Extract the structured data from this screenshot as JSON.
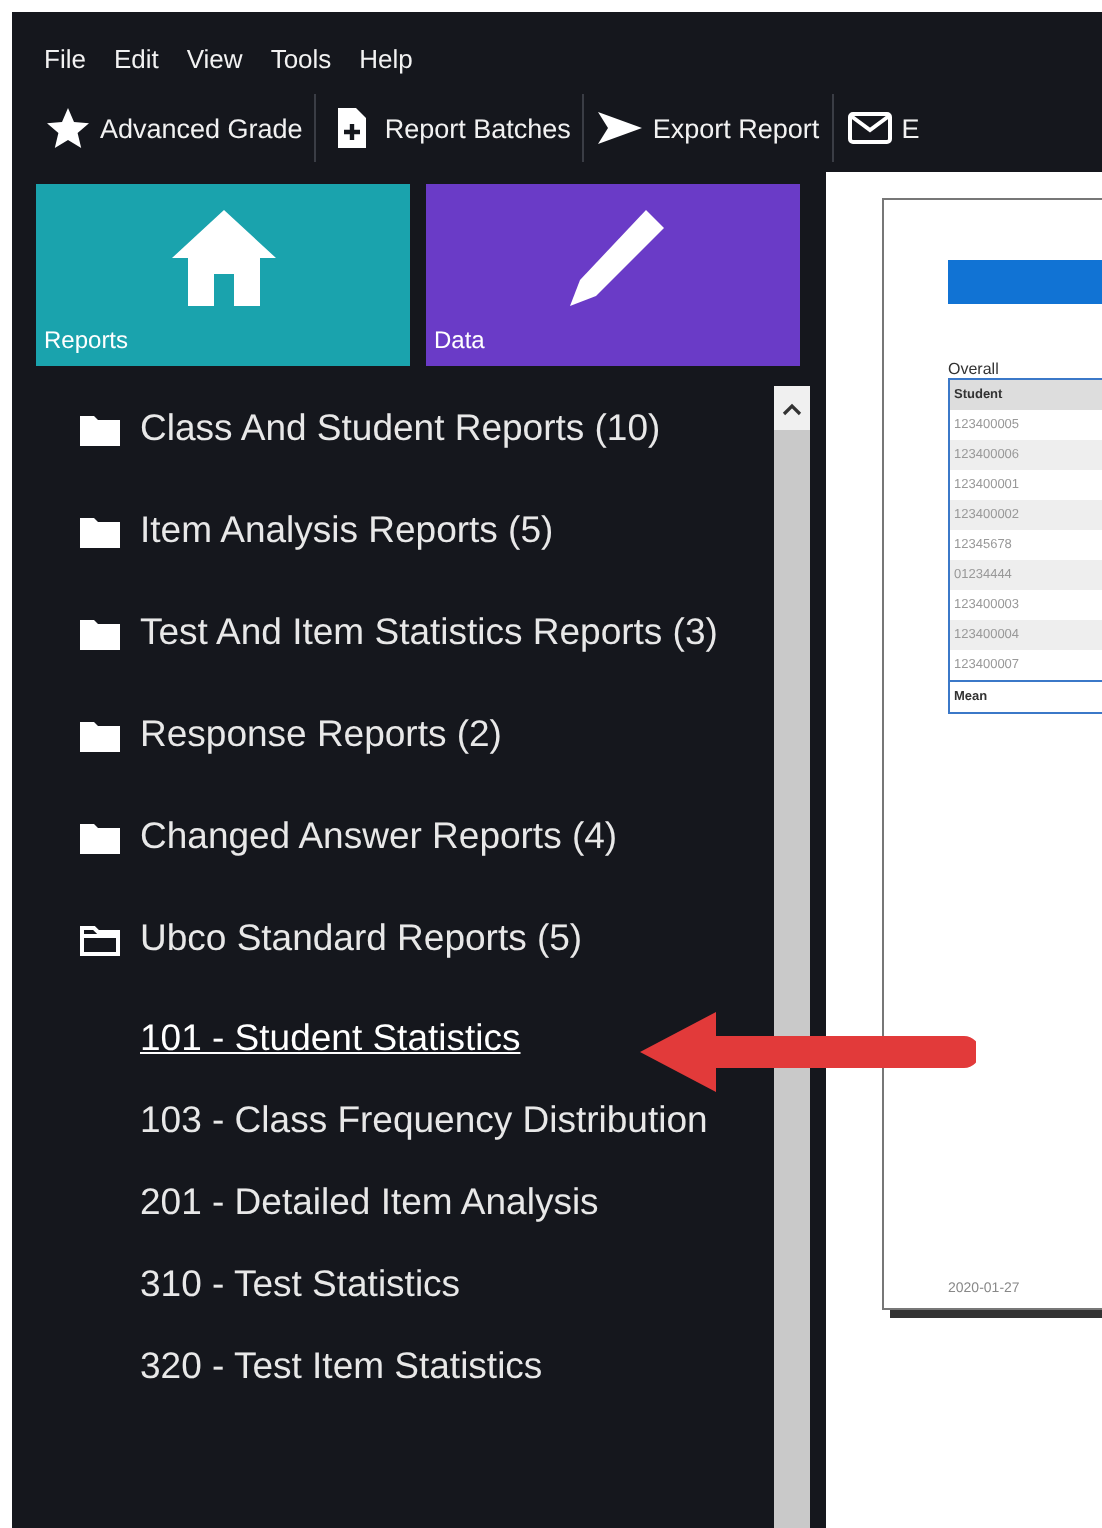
{
  "menu": [
    {
      "label": "File"
    },
    {
      "label": "Edit"
    },
    {
      "label": "View"
    },
    {
      "label": "Tools"
    },
    {
      "label": "Help"
    }
  ],
  "toolbar": [
    {
      "label": "Advanced Grade"
    },
    {
      "label": "Report Batches"
    },
    {
      "label": "Export Report"
    },
    {
      "label": "E"
    }
  ],
  "tiles": [
    {
      "label": "Reports",
      "color": "#1aa3ad"
    },
    {
      "label": "Data",
      "color": "#6a3bc7"
    }
  ],
  "tree": [
    {
      "label": "Class And Student Reports (10)",
      "expanded": false
    },
    {
      "label": "Item Analysis Reports (5)",
      "expanded": false
    },
    {
      "label": "Test And Item Statistics Reports (3)",
      "expanded": false
    },
    {
      "label": "Response Reports (2)",
      "expanded": false
    },
    {
      "label": "Changed Answer Reports (4)",
      "expanded": false
    },
    {
      "label": "Ubco Standard Reports (5)",
      "expanded": true,
      "children": [
        {
          "label": "101 - Student Statistics",
          "selected": true
        },
        {
          "label": "103 - Class Frequency Distribution",
          "selected": false
        },
        {
          "label": "201 - Detailed Item Analysis",
          "selected": false
        },
        {
          "label": "310 - Test Statistics",
          "selected": false
        },
        {
          "label": "320 - Test Item Statistics",
          "selected": false
        }
      ]
    }
  ],
  "preview": {
    "section": "Overall",
    "column_header": "Student",
    "rows": [
      "123400005",
      "123400006",
      "123400001",
      "123400002",
      "12345678",
      "01234444",
      "123400003",
      "123400004",
      "123400007"
    ],
    "footer": "Mean",
    "date": "2020-01-27"
  }
}
